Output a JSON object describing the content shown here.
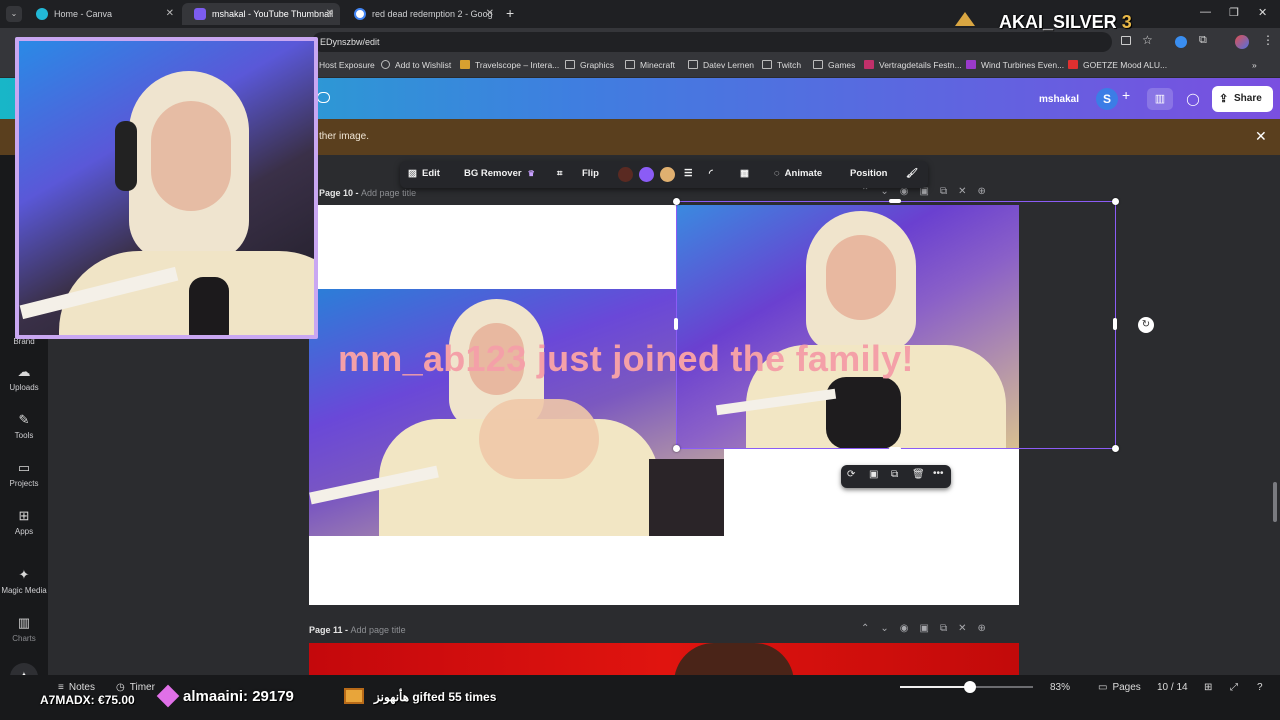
{
  "browser": {
    "tabs": [
      {
        "label": "Home - Canva",
        "active": false
      },
      {
        "label": "mshakal - YouTube Thumbnail",
        "active": true
      },
      {
        "label": "red dead redemption 2 - Goog",
        "active": false
      }
    ],
    "new_tab": "+",
    "address_partial": "EDynszbw/edit",
    "bookmarks": [
      "Host Exposure",
      "Add to Wishlist",
      "Travelscope – Intera...",
      "Graphics",
      "Minecraft",
      "Datev Lernen",
      "Twitch",
      "Games",
      "Vertragdetails Festn...",
      "Wind Turbines Even...",
      "GOETZE Mood ALU..."
    ]
  },
  "stream_overlay": {
    "channel_name": "AKAI_SILVER",
    "channel_count": "3",
    "donation_user": "A7MADX:",
    "donation_amount": "€75.00",
    "top_gifter": "almaaini: 29179",
    "gift_text": "هأنهونز gifted 55 times",
    "alert_text": "mm_ab123 just joined the family!"
  },
  "canva_header": {
    "user_name": "mshakal",
    "avatar_letter": "S",
    "share_label": "Share"
  },
  "notice": {
    "text": "ther image."
  },
  "sidebar": {
    "items": [
      {
        "label": "Brand",
        "icon": "brand-icon"
      },
      {
        "label": "Uploads",
        "icon": "upload-icon"
      },
      {
        "label": "Tools",
        "icon": "tools-icon"
      },
      {
        "label": "Projects",
        "icon": "folder-icon"
      },
      {
        "label": "Apps",
        "icon": "apps-icon"
      },
      {
        "label": "Magic Media",
        "icon": "magic-media-icon"
      },
      {
        "label": "Charts",
        "icon": "charts-icon"
      }
    ]
  },
  "toolbar": {
    "edit": "Edit",
    "bg_remover": "BG Remover",
    "flip": "Flip",
    "animate": "Animate",
    "position": "Position",
    "colors": [
      "#5a2a22",
      "#8b5cf6",
      "#e0b070"
    ]
  },
  "pages": {
    "page10": {
      "label": "Page 10 - ",
      "title_placeholder": "Add page title"
    },
    "page11": {
      "label": "Page 11 - ",
      "title_placeholder": "Add page title"
    }
  },
  "footer": {
    "notes": "Notes",
    "timer": "Timer",
    "zoom": "83%",
    "zoom_fraction": 0.53,
    "pages_label": "Pages",
    "page_count": "10 / 14"
  }
}
